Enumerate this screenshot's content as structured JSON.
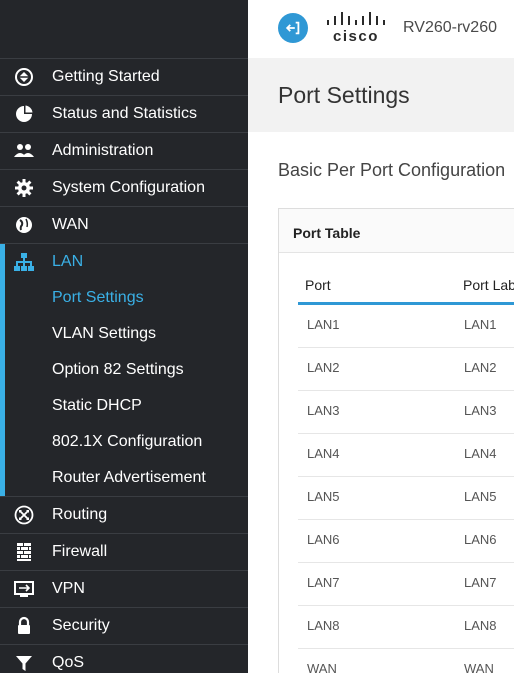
{
  "header": {
    "brand": "cisco",
    "device_name": "RV260-rv260",
    "back_icon": "exit-arrow-icon",
    "accent_color": "#2f98d5"
  },
  "sidebar": {
    "items": [
      {
        "label": "Getting Started",
        "icon": "compass-icon"
      },
      {
        "label": "Status and Statistics",
        "icon": "pie-chart-icon"
      },
      {
        "label": "Administration",
        "icon": "users-icon"
      },
      {
        "label": "System Configuration",
        "icon": "gear-icon"
      },
      {
        "label": "WAN",
        "icon": "globe-icon"
      },
      {
        "label": "LAN",
        "icon": "network-icon",
        "active": true
      },
      {
        "label": "Routing",
        "icon": "routing-icon"
      },
      {
        "label": "Firewall",
        "icon": "firewall-icon"
      },
      {
        "label": "VPN",
        "icon": "monitor-icon"
      },
      {
        "label": "Security",
        "icon": "lock-icon"
      },
      {
        "label": "QoS",
        "icon": "filter-icon"
      }
    ],
    "lan_subitems": [
      {
        "label": "Port Settings",
        "active": true
      },
      {
        "label": "VLAN Settings"
      },
      {
        "label": "Option 82 Settings"
      },
      {
        "label": "Static DHCP"
      },
      {
        "label": "802.1X Configuration"
      },
      {
        "label": "Router Advertisement"
      }
    ],
    "active_color": "#3ab0e6"
  },
  "main": {
    "page_title": "Port Settings",
    "section_title": "Basic Per Port Configuration",
    "port_table": {
      "title": "Port Table",
      "columns": [
        "Port",
        "Port Label"
      ],
      "rows": [
        [
          "LAN1",
          "LAN1"
        ],
        [
          "LAN2",
          "LAN2"
        ],
        [
          "LAN3",
          "LAN3"
        ],
        [
          "LAN4",
          "LAN4"
        ],
        [
          "LAN5",
          "LAN5"
        ],
        [
          "LAN6",
          "LAN6"
        ],
        [
          "LAN7",
          "LAN7"
        ],
        [
          "LAN8",
          "LAN8"
        ],
        [
          "WAN",
          "WAN"
        ]
      ]
    }
  }
}
